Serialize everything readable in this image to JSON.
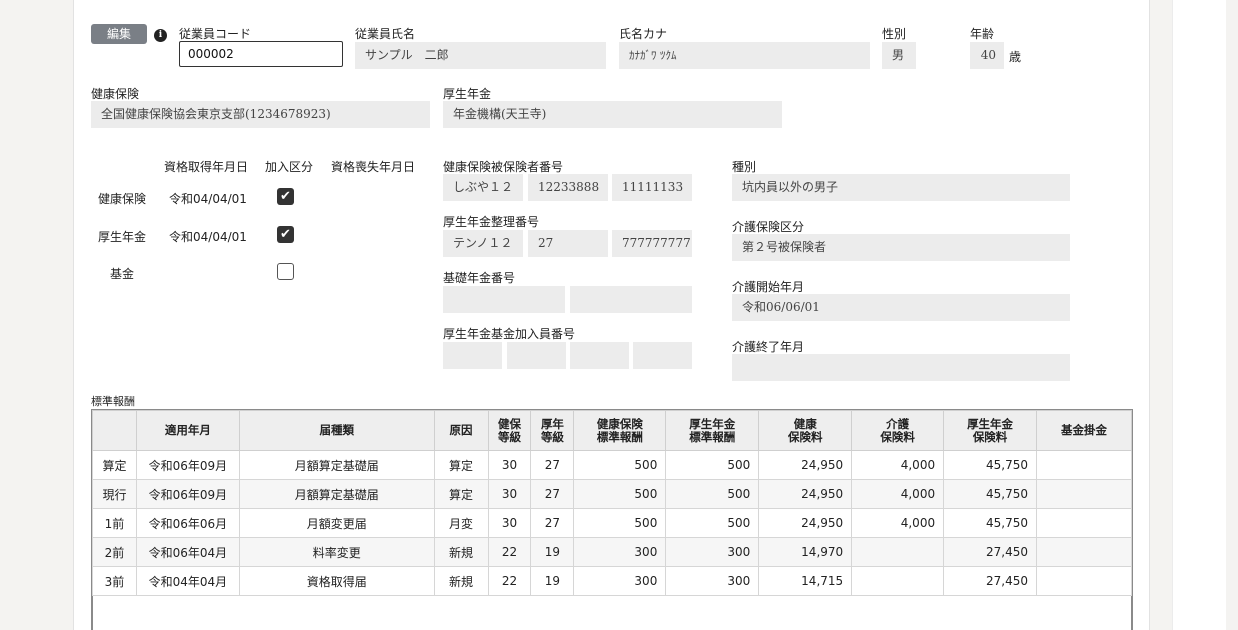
{
  "header": {
    "edit_label": "編集",
    "info_icon": "i",
    "employee_code_label": "従業員コード",
    "employee_code_value": "000002",
    "employee_name_label": "従業員氏名",
    "employee_name_value": "サンプル　二郎",
    "kana_label": "氏名カナ",
    "kana_value": "ｶﾅｶﾞﾜ ﾂｸﾑ",
    "gender_label": "性別",
    "gender_value": "男",
    "age_label": "年齢",
    "age_value": "40",
    "age_unit": "歳"
  },
  "insurance": {
    "health_label": "健康保険",
    "health_value": "全国健康保険協会東京支部(1234678923)",
    "pension_label": "厚生年金",
    "pension_value": "年金機構(天王寺)"
  },
  "qualifications": {
    "col_acquired": "資格取得年月日",
    "col_joined": "加入区分",
    "col_lost": "資格喪失年月日",
    "rows": [
      {
        "label": "健康保険",
        "acquired": "令和04/04/01",
        "joined": true
      },
      {
        "label": "厚生年金",
        "acquired": "令和04/04/01",
        "joined": true
      },
      {
        "label": "基金",
        "acquired": "",
        "joined": false
      }
    ]
  },
  "numbers": {
    "health_insured_label": "健康保険被保険者番号",
    "health_insured_values": [
      "しぶや１２",
      "12233888",
      "11111133"
    ],
    "pension_ref_label": "厚生年金整理番号",
    "pension_ref_values": [
      "テンノ１２",
      "27",
      "777777777"
    ],
    "basic_pension_label": "基礎年金番号",
    "fund_member_label": "厚生年金基金加入員番号"
  },
  "care": {
    "type_label": "種別",
    "type_value": "坑内員以外の男子",
    "care_class_label": "介護保険区分",
    "care_class_value": "第２号被保険者",
    "care_start_label": "介護開始年月",
    "care_start_value": "令和06/06/01",
    "care_end_label": "介護終了年月",
    "care_end_value": ""
  },
  "table": {
    "title": "標準報酬",
    "headers": [
      "",
      "適用年月",
      "届種類",
      "原因",
      "健保\n等級",
      "厚年\n等級",
      "健康保険\n標準報酬",
      "厚生年金\n標準報酬",
      "健康\n保険料",
      "介護\n保険料",
      "厚生年金\n保険料",
      "基金掛金"
    ],
    "rows": [
      [
        "算定",
        "令和06年09月",
        "月額算定基礎届",
        "算定",
        "30",
        "27",
        "500",
        "500",
        "24,950",
        "4,000",
        "45,750",
        ""
      ],
      [
        "現行",
        "令和06年09月",
        "月額算定基礎届",
        "算定",
        "30",
        "27",
        "500",
        "500",
        "24,950",
        "4,000",
        "45,750",
        ""
      ],
      [
        "1前",
        "令和06年06月",
        "月額変更届",
        "月変",
        "30",
        "27",
        "500",
        "500",
        "24,950",
        "4,000",
        "45,750",
        ""
      ],
      [
        "2前",
        "令和06年04月",
        "料率変更",
        "新規",
        "22",
        "19",
        "300",
        "300",
        "14,970",
        "",
        "27,450",
        ""
      ],
      [
        "3前",
        "令和04年04月",
        "資格取得届",
        "新規",
        "22",
        "19",
        "300",
        "300",
        "14,715",
        "",
        "27,450",
        ""
      ]
    ]
  }
}
